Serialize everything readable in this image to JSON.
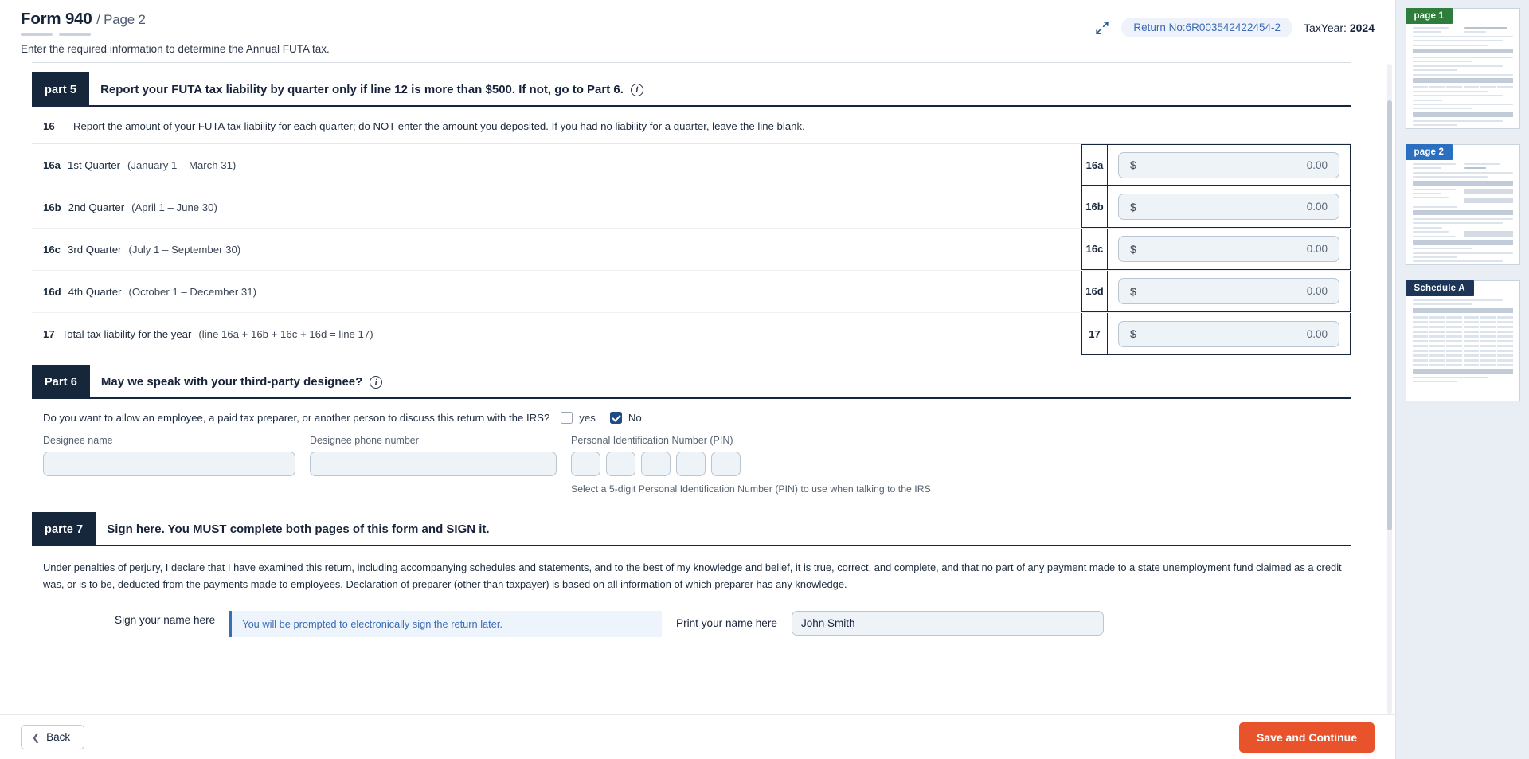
{
  "header": {
    "form_title": "Form 940",
    "page_sep": "/ Page 2",
    "subtitle": "Enter the required information to determine the Annual FUTA tax.",
    "collapse_icon": "collapse-arrows-icon",
    "return_no": "Return No:6R003542422454-2",
    "taxyear_label": "TaxYear:",
    "taxyear_value": "2024"
  },
  "part5": {
    "tag": "part 5",
    "title": "Report your FUTA tax liability by quarter only if line 12 is more than $500. If not, go to Part 6.",
    "info_icon": "info-circle-icon",
    "line16": {
      "num": "16",
      "text": "Report the amount of your FUTA tax liability for each quarter; do NOT enter the amount you deposited. If you had no liability for a quarter, leave the line blank."
    },
    "rows": [
      {
        "code": "16a",
        "quarter": "1st Quarter",
        "dates": "(January 1 – March 31)",
        "cell_code": "16a",
        "currency": "$",
        "value": "0.00"
      },
      {
        "code": "16b",
        "quarter": "2nd Quarter",
        "dates": "(April 1 – June 30)",
        "cell_code": "16b",
        "currency": "$",
        "value": "0.00"
      },
      {
        "code": "16c",
        "quarter": "3rd Quarter",
        "dates": "(July 1 – September 30)",
        "cell_code": "16c",
        "currency": "$",
        "value": "0.00"
      },
      {
        "code": "16d",
        "quarter": "4th Quarter",
        "dates": "(October 1 – December 31)",
        "cell_code": "16d",
        "currency": "$",
        "value": "0.00"
      },
      {
        "code": "17",
        "quarter": "Total tax liability for the year",
        "dates": "(line 16a + 16b + 16c + 16d = line 17)",
        "cell_code": "17",
        "currency": "$",
        "value": "0.00"
      }
    ]
  },
  "part6": {
    "tag": "Part 6",
    "title": "May we speak with your third-party designee?",
    "info_icon": "info-circle-icon",
    "question": "Do you want to allow an employee, a paid tax preparer, or another person to discuss this return with the IRS?",
    "yes_label": "yes",
    "yes_checked": false,
    "no_label": "No",
    "no_checked": true,
    "designee_name_label": "Designee name",
    "designee_name_value": "",
    "designee_phone_label": "Designee phone number",
    "designee_phone_value": "",
    "pin_label": "Personal Identification Number (PIN)",
    "pin_digits": [
      "",
      "",
      "",
      "",
      ""
    ],
    "pin_hint": "Select a 5-digit Personal Identification Number (PIN) to use when talking to the IRS"
  },
  "part7": {
    "tag": "parte 7",
    "title": "Sign here. You MUST complete both pages of this form and SIGN it.",
    "perjury": "Under penalties of perjury, I declare that I have examined this return, including accompanying schedules and statements, and to the best of my knowledge and belief, it is true, correct, and complete, and that no part of any payment made to a state unemployment fund claimed as a credit was, or is to be, deducted from the payments made to employees. Declaration of preparer (other than taxpayer) is based on all information of which preparer has any knowledge.",
    "sign_label": "Sign your name here",
    "sign_note": "You will be prompted to electronically sign the return later.",
    "print_name_label": "Print your name here",
    "print_name_value": "John Smith"
  },
  "footer": {
    "back_label": "Back",
    "back_icon": "chevron-left-icon",
    "save_label": "Save and Continue",
    "accent_color": "#e8532b"
  },
  "thumbnails": [
    {
      "badge": "page 1",
      "badge_color": "#2f7d3a"
    },
    {
      "badge": "page 2",
      "badge_color": "#2b6fc1"
    },
    {
      "badge": "Schedule A",
      "badge_color": "#1d3557"
    }
  ]
}
